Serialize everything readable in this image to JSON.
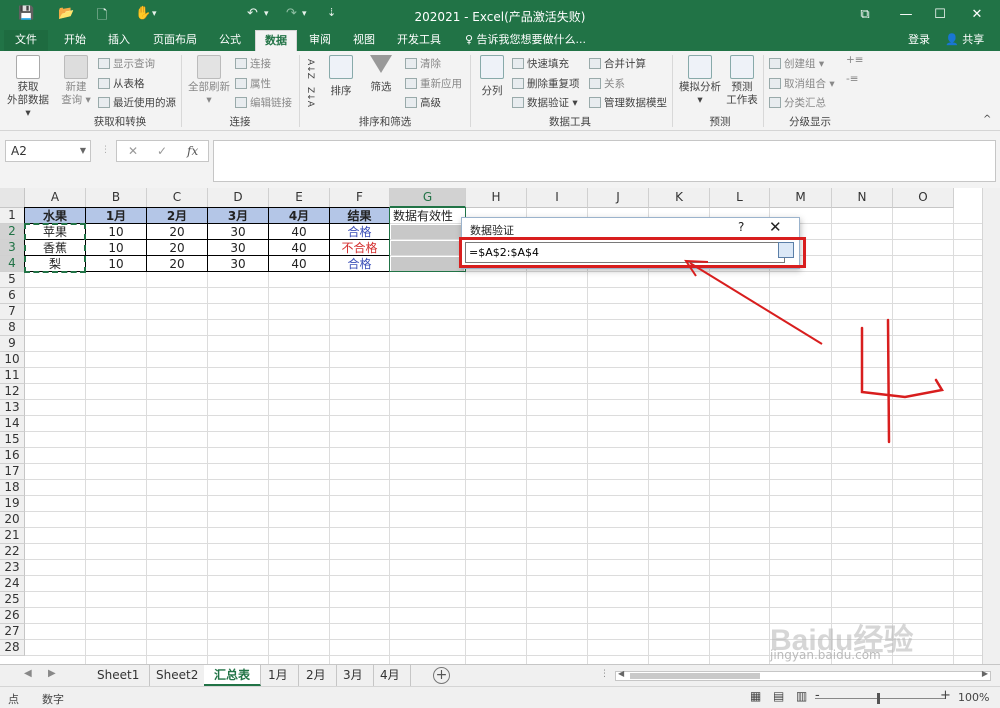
{
  "window": {
    "title": "202021 - Excel(产品激活失败)",
    "buttons": [
      "⧉",
      "—",
      "☐",
      "✕"
    ]
  },
  "quick_access": [
    "💾",
    "📂",
    "🗋",
    "✋",
    "▾",
    "↶",
    "▾",
    "↷",
    "▾",
    "⇣"
  ],
  "ribbon_tabs": [
    {
      "label": "文件"
    },
    {
      "label": "开始"
    },
    {
      "label": "插入"
    },
    {
      "label": "页面布局"
    },
    {
      "label": "公式"
    },
    {
      "label": "数据"
    },
    {
      "label": "审阅"
    },
    {
      "label": "视图"
    },
    {
      "label": "开发工具"
    }
  ],
  "tell_me": "♀ 告诉我您想要做什么...",
  "account": {
    "login": "登录",
    "share": "👤 共享"
  },
  "ribbon": {
    "get_external": [
      "获取",
      "外部数据 ▾"
    ],
    "new_query": [
      "新建",
      "查询 ▾"
    ],
    "show_query": "显示查询",
    "from_table": "从表格",
    "recent_sources": "最近使用的源",
    "group_get_transform": "获取和转换",
    "refresh_all": [
      "全部刷新",
      "▾"
    ],
    "connections": "连接",
    "properties": "属性",
    "edit_links": "编辑链接",
    "group_connections": "连接",
    "sort_az": "A↓Z",
    "sort_za": "Z↓A",
    "sort": "排序",
    "filter": "筛选",
    "clear": "清除",
    "reapply": "重新应用",
    "advanced": "高级",
    "group_sort_filter": "排序和筛选",
    "text_to_columns": "分列",
    "flash_fill": "快速填充",
    "remove_duplicates": "删除重复项",
    "data_validation": "数据验证 ▾",
    "consolidate": "合并计算",
    "relationships": "关系",
    "manage_model": "管理数据模型",
    "group_data_tools": "数据工具",
    "what_if": [
      "模拟分析",
      "▾"
    ],
    "forecast_sheet": [
      "预测",
      "工作表"
    ],
    "group_forecast": "预测",
    "group_outline": "创建组 ▾",
    "ungroup": "取消组合 ▾",
    "subtotal": "分类汇总",
    "group_outline_label": "分级显示"
  },
  "formula_bar": {
    "name_box": "A2",
    "cancel": "✕",
    "enter": "✓",
    "fx": "fx",
    "formula": ""
  },
  "columns": [
    "A",
    "B",
    "C",
    "D",
    "E",
    "F",
    "G",
    "H",
    "I",
    "J",
    "K",
    "L",
    "M",
    "N",
    "O"
  ],
  "rows": [
    "1",
    "2",
    "3",
    "4",
    "5",
    "6",
    "7",
    "8",
    "9",
    "10",
    "11",
    "12",
    "13",
    "14",
    "15",
    "16",
    "17",
    "18",
    "19",
    "20",
    "21",
    "22",
    "23",
    "24",
    "25",
    "26",
    "27",
    "28"
  ],
  "table": {
    "headers": [
      "水果",
      "1月",
      "2月",
      "3月",
      "4月",
      "结果",
      "数据有效性"
    ],
    "rows": [
      [
        "苹果",
        "10",
        "20",
        "30",
        "40",
        "合格"
      ],
      [
        "香蕉",
        "10",
        "20",
        "30",
        "40",
        "不合格"
      ],
      [
        "梨",
        "10",
        "20",
        "30",
        "40",
        "合格"
      ]
    ],
    "result_colors": {
      "合格": "#3b4fb8",
      "不合格": "#d42f2f"
    }
  },
  "dialog": {
    "title": "数据验证",
    "help": "?",
    "close": "✕",
    "reference": "=$A$2:$A$4"
  },
  "annotation": {
    "handwritten": "4",
    "color": "#d81e1e"
  },
  "sheet_tabs": [
    {
      "label": "Sheet1"
    },
    {
      "label": "Sheet2"
    },
    {
      "label": "汇总表"
    },
    {
      "label": "1月"
    },
    {
      "label": "2月"
    },
    {
      "label": "3月"
    },
    {
      "label": "4月"
    }
  ],
  "status": {
    "mode": "点",
    "num": "数字",
    "zoom": "100%",
    "zoom_minus": "-",
    "zoom_plus": "+"
  },
  "watermark": "Baidu经验 jingyan.baidu.com"
}
